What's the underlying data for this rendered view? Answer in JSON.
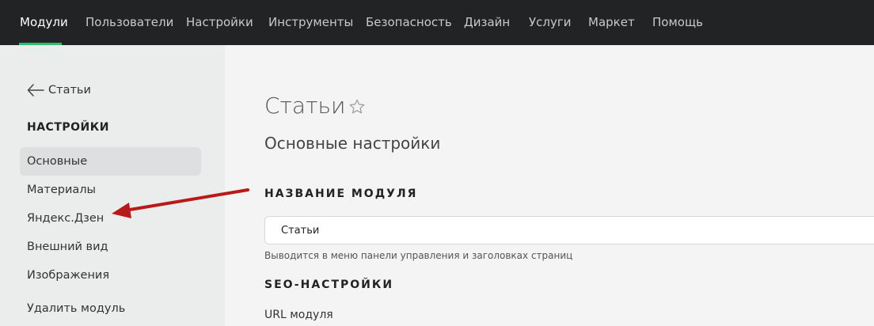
{
  "topnav": {
    "items": [
      {
        "label": "Модули"
      },
      {
        "label": "Пользователи"
      },
      {
        "label": "Настройки"
      },
      {
        "label": "Инструменты"
      },
      {
        "label": "Безопасность"
      },
      {
        "label": "Дизайн"
      },
      {
        "label": "Услуги"
      },
      {
        "label": "Маркет"
      },
      {
        "label": "Помощь"
      }
    ],
    "active_color": "#2bbf6c"
  },
  "sidebar": {
    "back_label": "Статьи",
    "section_title": "НАСТРОЙКИ",
    "items": [
      {
        "label": "Основные"
      },
      {
        "label": "Материалы"
      },
      {
        "label": "Яндекс.Дзен"
      },
      {
        "label": "Внешний вид"
      },
      {
        "label": "Изображения"
      },
      {
        "label": "Удалить модуль"
      }
    ]
  },
  "main": {
    "title": "Статьи",
    "subtitle": "Основные настройки",
    "module_name": {
      "heading": "НАЗВАНИЕ МОДУЛЯ",
      "value": "Статьи",
      "hint": "Выводится в меню панели управления и заголовках страниц"
    },
    "seo": {
      "heading": "SEO-НАСТРОЙКИ",
      "url_label": "URL модуля"
    }
  },
  "annotation": {
    "arrow_color": "#b81a1a"
  }
}
